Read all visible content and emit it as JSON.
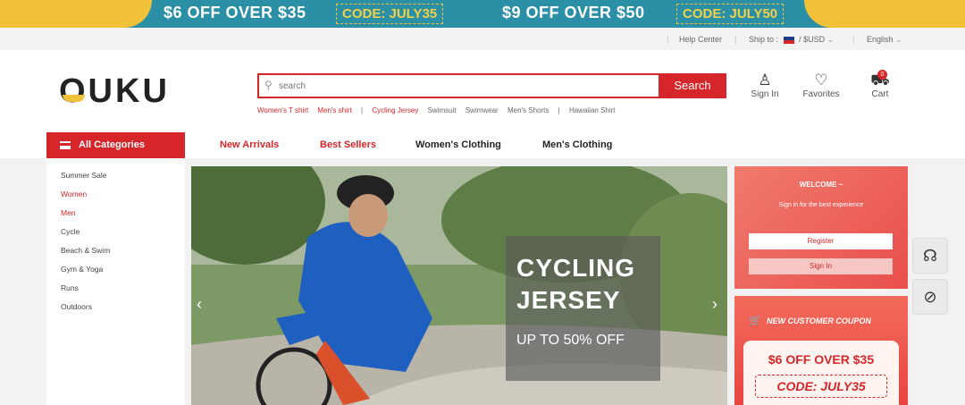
{
  "promo": {
    "offer1": "$6 OFF OVER $35",
    "code1": "CODE: JULY35",
    "offer2": "$9 OFF OVER $50",
    "code2": "CODE: JULY50"
  },
  "util": {
    "help": "Help Center",
    "ship": "Ship to :",
    "currency": "/ $USD",
    "language": "English"
  },
  "header": {
    "logo": "OUKU",
    "search_placeholder": "search",
    "search_button": "Search",
    "hot_searches": [
      "Women's T shirt",
      "Men's shirt",
      "Cycling Jersey",
      "Swimsuit",
      "Swimwear",
      "Men's Shorts",
      "Hawaiian Shirt"
    ],
    "signin": "Sign In",
    "favorites": "Favorites",
    "cart": "Cart",
    "cart_count": "0"
  },
  "nav": {
    "all_categories": "All Categories",
    "items": [
      "New Arrivals",
      "Best Sellers",
      "Women's Clothing",
      "Men's Clothing"
    ]
  },
  "sidebar": [
    "Summer Sale",
    "Women",
    "Men",
    "Cycle",
    "Beach & Swim",
    "Gym & Yoga",
    "Runs",
    "Outdoors"
  ],
  "banner": {
    "line1": "CYCLING",
    "line2": "JERSEY",
    "line3": "UP TO 50% OFF"
  },
  "welcome": {
    "title": "WELCOME ~",
    "subtitle": "Sign in for the best experience",
    "register": "Register",
    "signin": "Sign In"
  },
  "coupon": {
    "header": "NEW CUSTOMER COUPON",
    "offer": "$6 OFF OVER $35",
    "code": "CODE: JULY35"
  },
  "colors": {
    "accent": "#d7262a",
    "promo_teal": "#2b8fa5",
    "promo_yellow": "#f2c13a"
  }
}
